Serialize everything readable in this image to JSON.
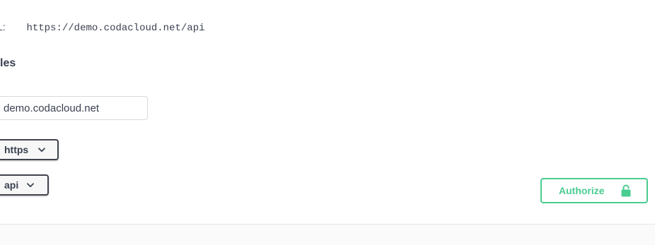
{
  "servers": {
    "url_label": "L:",
    "url_value": "https://demo.codacloud.net/api",
    "section_title": "les",
    "host_input_value": "demo.codacloud.net",
    "scheme_select": {
      "value": "https"
    },
    "basepath_select": {
      "value": "api"
    }
  },
  "auth": {
    "authorize_label": "Authorize",
    "icon": "unlocked-padlock-icon",
    "accent_color": "#49cc90"
  }
}
